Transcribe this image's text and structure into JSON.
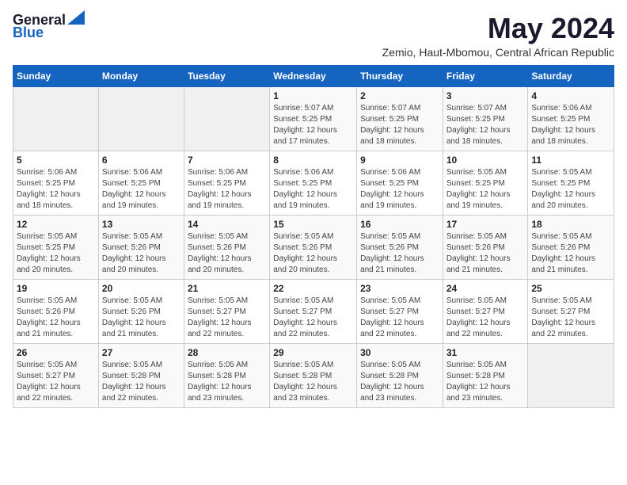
{
  "logo": {
    "line1": "General",
    "line2": "Blue",
    "arrow_color": "#1565c0"
  },
  "title": "May 2024",
  "subtitle": "Zemio, Haut-Mbomou, Central African Republic",
  "header_days": [
    "Sunday",
    "Monday",
    "Tuesday",
    "Wednesday",
    "Thursday",
    "Friday",
    "Saturday"
  ],
  "weeks": [
    [
      {
        "day": "",
        "info": ""
      },
      {
        "day": "",
        "info": ""
      },
      {
        "day": "",
        "info": ""
      },
      {
        "day": "1",
        "info": "Sunrise: 5:07 AM\nSunset: 5:25 PM\nDaylight: 12 hours\nand 17 minutes."
      },
      {
        "day": "2",
        "info": "Sunrise: 5:07 AM\nSunset: 5:25 PM\nDaylight: 12 hours\nand 18 minutes."
      },
      {
        "day": "3",
        "info": "Sunrise: 5:07 AM\nSunset: 5:25 PM\nDaylight: 12 hours\nand 18 minutes."
      },
      {
        "day": "4",
        "info": "Sunrise: 5:06 AM\nSunset: 5:25 PM\nDaylight: 12 hours\nand 18 minutes."
      }
    ],
    [
      {
        "day": "5",
        "info": "Sunrise: 5:06 AM\nSunset: 5:25 PM\nDaylight: 12 hours\nand 18 minutes."
      },
      {
        "day": "6",
        "info": "Sunrise: 5:06 AM\nSunset: 5:25 PM\nDaylight: 12 hours\nand 19 minutes."
      },
      {
        "day": "7",
        "info": "Sunrise: 5:06 AM\nSunset: 5:25 PM\nDaylight: 12 hours\nand 19 minutes."
      },
      {
        "day": "8",
        "info": "Sunrise: 5:06 AM\nSunset: 5:25 PM\nDaylight: 12 hours\nand 19 minutes."
      },
      {
        "day": "9",
        "info": "Sunrise: 5:06 AM\nSunset: 5:25 PM\nDaylight: 12 hours\nand 19 minutes."
      },
      {
        "day": "10",
        "info": "Sunrise: 5:05 AM\nSunset: 5:25 PM\nDaylight: 12 hours\nand 19 minutes."
      },
      {
        "day": "11",
        "info": "Sunrise: 5:05 AM\nSunset: 5:25 PM\nDaylight: 12 hours\nand 20 minutes."
      }
    ],
    [
      {
        "day": "12",
        "info": "Sunrise: 5:05 AM\nSunset: 5:25 PM\nDaylight: 12 hours\nand 20 minutes."
      },
      {
        "day": "13",
        "info": "Sunrise: 5:05 AM\nSunset: 5:26 PM\nDaylight: 12 hours\nand 20 minutes."
      },
      {
        "day": "14",
        "info": "Sunrise: 5:05 AM\nSunset: 5:26 PM\nDaylight: 12 hours\nand 20 minutes."
      },
      {
        "day": "15",
        "info": "Sunrise: 5:05 AM\nSunset: 5:26 PM\nDaylight: 12 hours\nand 20 minutes."
      },
      {
        "day": "16",
        "info": "Sunrise: 5:05 AM\nSunset: 5:26 PM\nDaylight: 12 hours\nand 21 minutes."
      },
      {
        "day": "17",
        "info": "Sunrise: 5:05 AM\nSunset: 5:26 PM\nDaylight: 12 hours\nand 21 minutes."
      },
      {
        "day": "18",
        "info": "Sunrise: 5:05 AM\nSunset: 5:26 PM\nDaylight: 12 hours\nand 21 minutes."
      }
    ],
    [
      {
        "day": "19",
        "info": "Sunrise: 5:05 AM\nSunset: 5:26 PM\nDaylight: 12 hours\nand 21 minutes."
      },
      {
        "day": "20",
        "info": "Sunrise: 5:05 AM\nSunset: 5:26 PM\nDaylight: 12 hours\nand 21 minutes."
      },
      {
        "day": "21",
        "info": "Sunrise: 5:05 AM\nSunset: 5:27 PM\nDaylight: 12 hours\nand 22 minutes."
      },
      {
        "day": "22",
        "info": "Sunrise: 5:05 AM\nSunset: 5:27 PM\nDaylight: 12 hours\nand 22 minutes."
      },
      {
        "day": "23",
        "info": "Sunrise: 5:05 AM\nSunset: 5:27 PM\nDaylight: 12 hours\nand 22 minutes."
      },
      {
        "day": "24",
        "info": "Sunrise: 5:05 AM\nSunset: 5:27 PM\nDaylight: 12 hours\nand 22 minutes."
      },
      {
        "day": "25",
        "info": "Sunrise: 5:05 AM\nSunset: 5:27 PM\nDaylight: 12 hours\nand 22 minutes."
      }
    ],
    [
      {
        "day": "26",
        "info": "Sunrise: 5:05 AM\nSunset: 5:27 PM\nDaylight: 12 hours\nand 22 minutes."
      },
      {
        "day": "27",
        "info": "Sunrise: 5:05 AM\nSunset: 5:28 PM\nDaylight: 12 hours\nand 22 minutes."
      },
      {
        "day": "28",
        "info": "Sunrise: 5:05 AM\nSunset: 5:28 PM\nDaylight: 12 hours\nand 23 minutes."
      },
      {
        "day": "29",
        "info": "Sunrise: 5:05 AM\nSunset: 5:28 PM\nDaylight: 12 hours\nand 23 minutes."
      },
      {
        "day": "30",
        "info": "Sunrise: 5:05 AM\nSunset: 5:28 PM\nDaylight: 12 hours\nand 23 minutes."
      },
      {
        "day": "31",
        "info": "Sunrise: 5:05 AM\nSunset: 5:28 PM\nDaylight: 12 hours\nand 23 minutes."
      },
      {
        "day": "",
        "info": ""
      }
    ]
  ]
}
